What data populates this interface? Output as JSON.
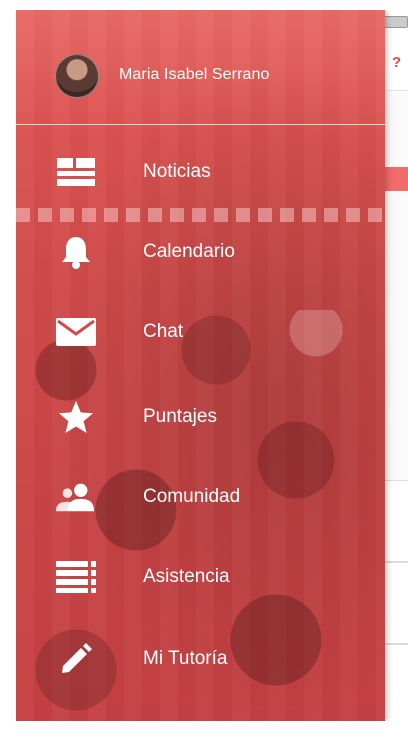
{
  "profile": {
    "name": "Maria Isabel Serrano"
  },
  "menu": {
    "items": [
      {
        "label": "Noticias",
        "icon": "news-icon"
      },
      {
        "label": "Calendario",
        "icon": "bell-icon"
      },
      {
        "label": "Chat",
        "icon": "envelope-icon"
      },
      {
        "label": "Puntajes",
        "icon": "star-icon"
      },
      {
        "label": "Comunidad",
        "icon": "people-icon"
      },
      {
        "label": "Asistencia",
        "icon": "list-icon"
      },
      {
        "label": "Mi Tutoría",
        "icon": "pencil-icon"
      }
    ]
  },
  "background_app": {
    "help_glyph": "?"
  },
  "colors": {
    "drawer_tint": "#d9514f",
    "accent": "#e0484f",
    "text": "#ffffff"
  }
}
